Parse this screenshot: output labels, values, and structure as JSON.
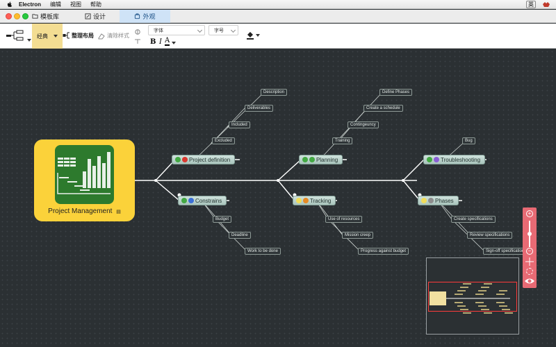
{
  "menubar": {
    "app_name": "Electron",
    "items": [
      "编辑",
      "视图",
      "帮助"
    ],
    "ime_label": "英"
  },
  "tabs": [
    {
      "label": "模板库",
      "icon": "folder-icon"
    },
    {
      "label": "设计",
      "icon": "edit-icon"
    },
    {
      "label": "外观",
      "icon": "palette-icon",
      "active": true
    }
  ],
  "toolbar": {
    "style_label": "经典",
    "layout_label": "整理布局",
    "clear_label": "清除样式",
    "font_placeholder": "字体",
    "size_placeholder": "字号",
    "bold": "B",
    "italic": "I",
    "font_color": "A"
  },
  "mindmap": {
    "central_title": "Project Management",
    "topics": {
      "definition": {
        "label": "Project definition",
        "leaves": [
          "Description",
          "Deliverables",
          "Included",
          "Excluded"
        ]
      },
      "planning": {
        "label": "Planning",
        "leaves": [
          "Define Phases",
          "Create a schedule",
          "Contingeuncy",
          "Training"
        ]
      },
      "troubleshooting": {
        "label": "Troubleshooting",
        "leaves": [
          "Bug"
        ]
      },
      "constrains": {
        "label": "Constrains",
        "leaves": [
          "Budget",
          "Deadline",
          "Work to be done"
        ]
      },
      "tracking": {
        "label": "Tracking",
        "leaves": [
          "Use of resources",
          "Mission creep",
          "Progress against budget"
        ]
      },
      "phases": {
        "label": "Phases",
        "leaves": [
          "Create specifications",
          "Review specifications",
          "Sign-off specifications"
        ]
      }
    }
  },
  "colors": {
    "canvas": "#2b3033",
    "central": "#fbd23a",
    "accent": "#e86a74",
    "active_tab": "#cfe3f7"
  }
}
